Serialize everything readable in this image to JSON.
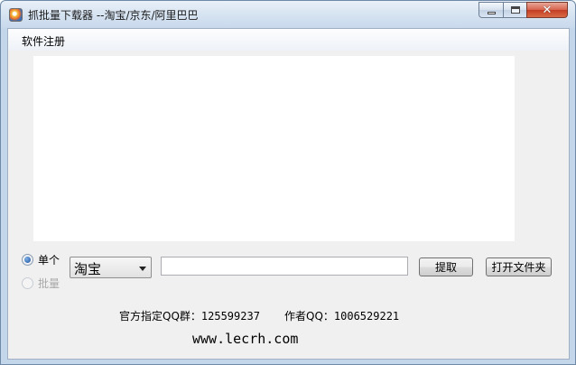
{
  "window": {
    "title": "抓批量下载器 --淘宝/京东/阿里巴巴",
    "controls": {
      "minimize": "minimize",
      "maximize": "maximize",
      "close": "✕"
    }
  },
  "menu": {
    "items": [
      {
        "label": "软件注册"
      }
    ]
  },
  "mode": {
    "single_label": "单个",
    "batch_label": "批量",
    "selected": "单个"
  },
  "source_select": {
    "value": "淘宝"
  },
  "url_input": {
    "value": "",
    "placeholder": ""
  },
  "buttons": {
    "extract": "提取",
    "open_folder": "打开文件夹"
  },
  "footer": {
    "qq_group_label": "官方指定QQ群：",
    "qq_group_number": "125599237",
    "author_label": "作者QQ：",
    "author_number": "1006529221",
    "website": "www.lecrh.com"
  },
  "icons": {
    "app": "app-icon",
    "minimize": "minimize-icon",
    "maximize": "maximize-icon",
    "close": "close-icon",
    "dropdown": "chevron-down-icon"
  }
}
